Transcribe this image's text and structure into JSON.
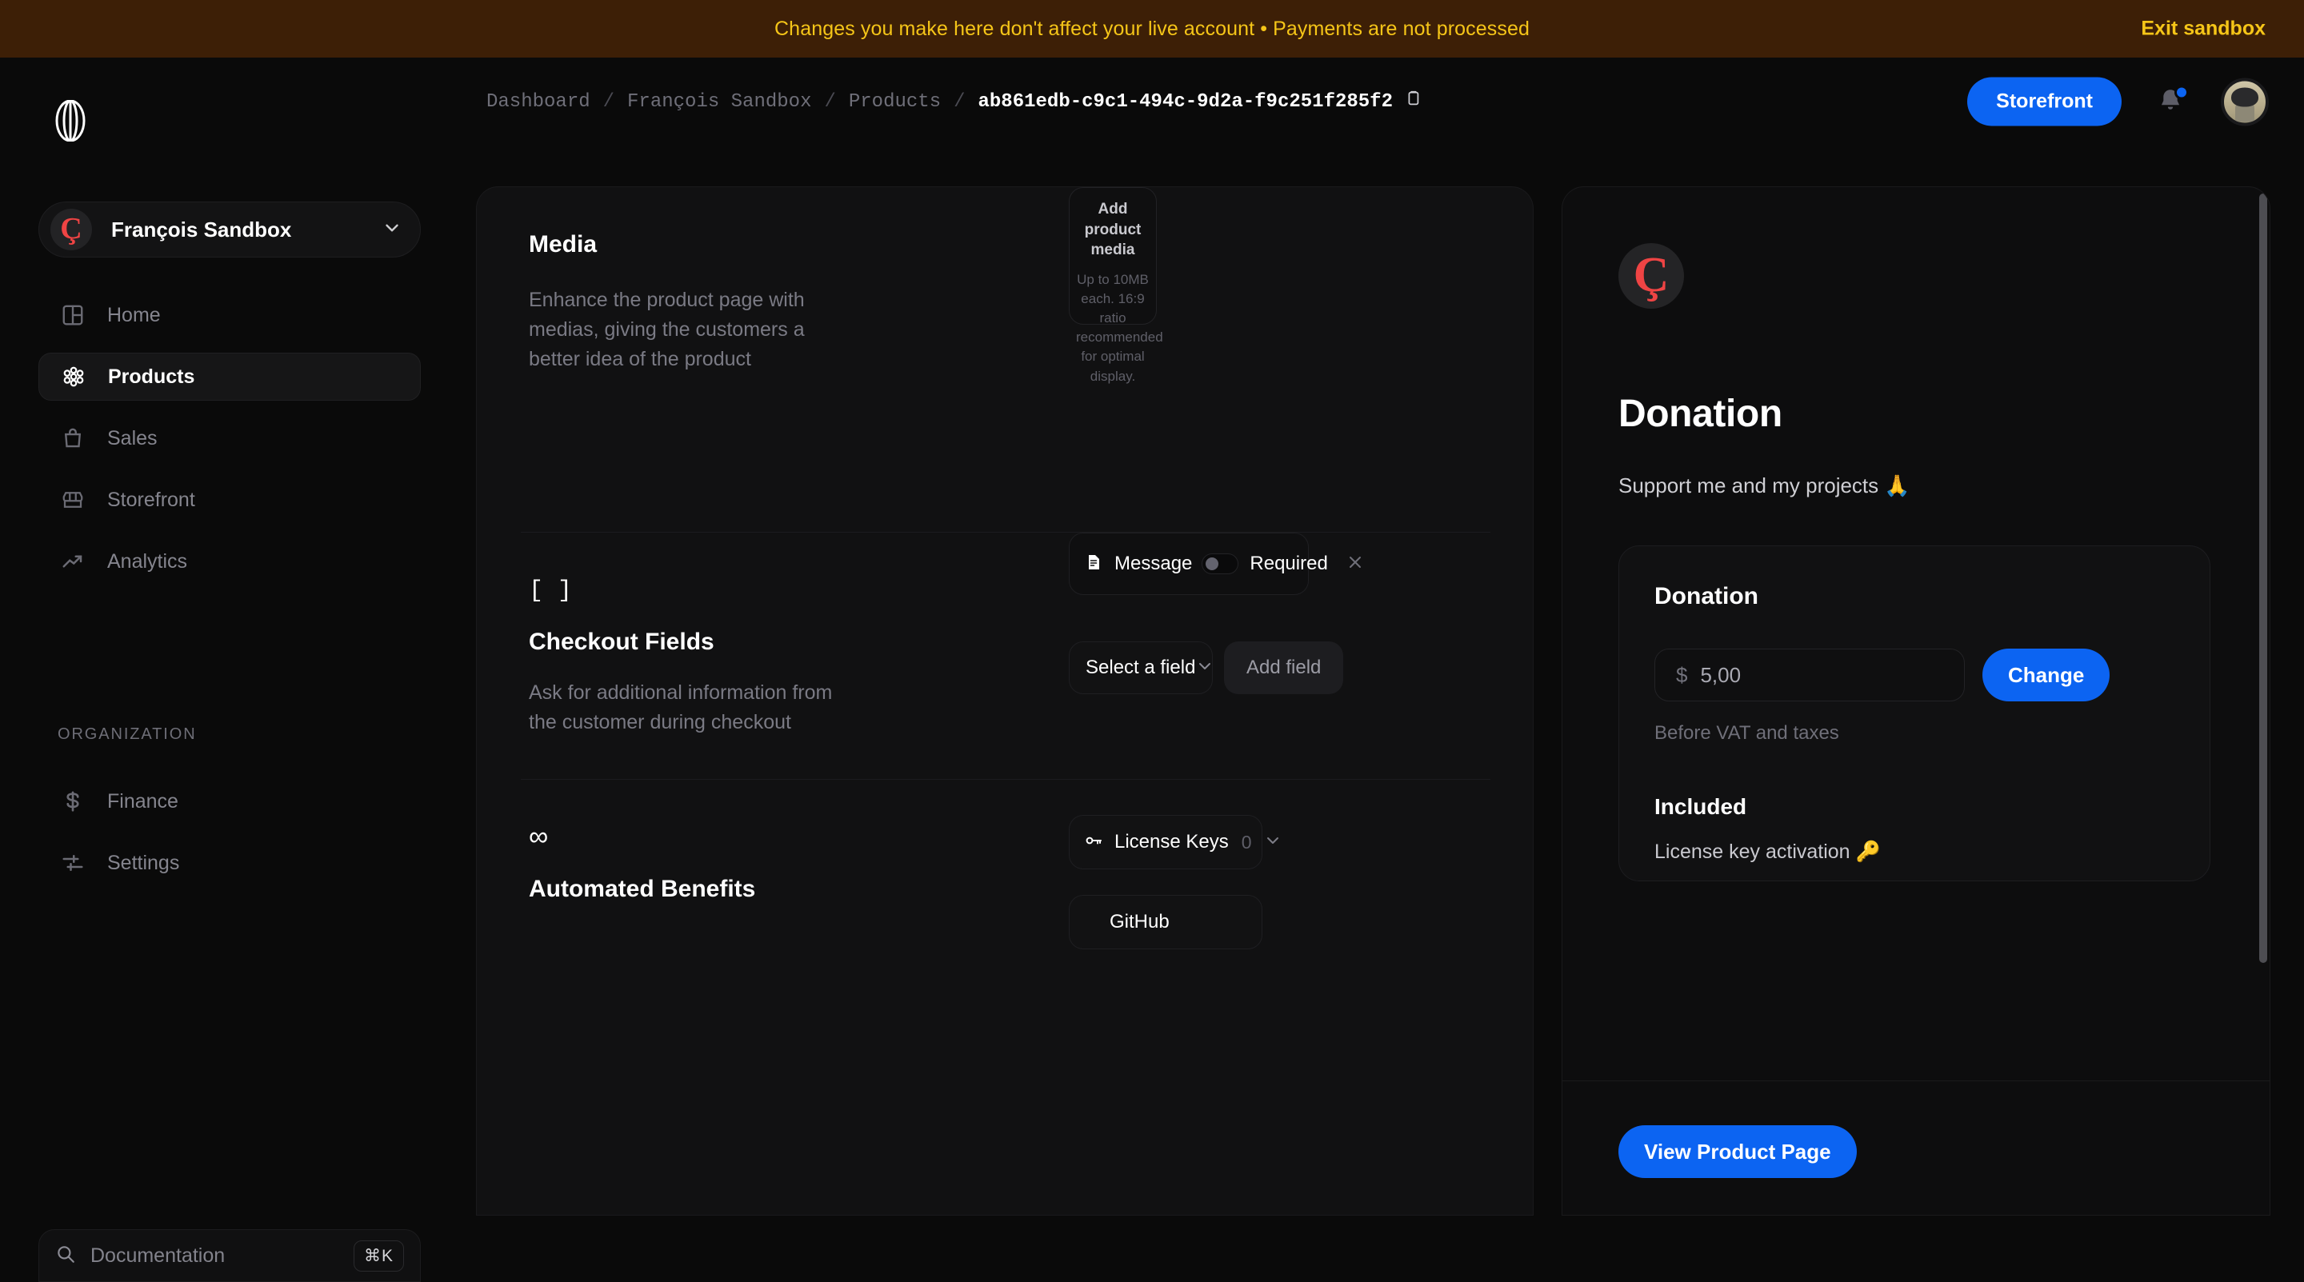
{
  "banner": {
    "message": "Changes you make here don't affect your live account • Payments are not processed",
    "exit_label": "Exit sandbox",
    "bg_color": "#3d1f06",
    "text_color": "#f5c518"
  },
  "sidebar": {
    "logo_icon": "polar-logo-icon",
    "org_switcher": {
      "avatar_letter": "Ç",
      "name": "François Sandbox",
      "chevron_icon": "chevron-down-icon"
    },
    "nav_main": [
      {
        "label": "Home",
        "icon": "layout-dashboard-icon",
        "active": false
      },
      {
        "label": "Products",
        "icon": "flower-products-icon",
        "active": true
      },
      {
        "label": "Sales",
        "icon": "shopping-bag-icon",
        "active": false
      },
      {
        "label": "Storefront",
        "icon": "storefront-icon",
        "active": false
      },
      {
        "label": "Analytics",
        "icon": "trending-up-icon",
        "active": false
      }
    ],
    "org_section_heading": "ORGANIZATION",
    "nav_org": [
      {
        "label": "Finance",
        "icon": "dollar-sign-icon",
        "active": false
      },
      {
        "label": "Settings",
        "icon": "sliders-icon",
        "active": false
      }
    ],
    "doc_search": {
      "icon": "search-icon",
      "placeholder": "Documentation",
      "shortcut": "⌘K"
    }
  },
  "topbar": {
    "breadcrumb": {
      "items": [
        "Dashboard",
        "François Sandbox",
        "Products"
      ],
      "separator": "/",
      "current": "ab861edb-c9c1-494c-9d2a-f9c251f285f2",
      "copy_icon": "clipboard-copy-icon"
    },
    "storefront_button": "Storefront",
    "storefront_color": "#0c64f2",
    "bell_icon": "bell-icon",
    "has_notification": true,
    "notification_color": "#0c64f2",
    "avatar_name": "avatar"
  },
  "editor": {
    "media": {
      "icon": "image-icon",
      "title": "Media",
      "description": "Enhance the product page with medias, giving the customers a better idea of the product",
      "dropzone": {
        "title": "Add product media",
        "hint": "Up to 10MB each. 16:9 ratio recommended for optimal display."
      }
    },
    "checkout_fields": {
      "icon": "[ ]",
      "title": "Checkout Fields",
      "description": "Ask for additional information from the customer during checkout",
      "fields": [
        {
          "icon": "text-field-icon",
          "name": "Message",
          "required_label": "Required",
          "required_toggle_on": false,
          "remove_icon": "close-icon"
        }
      ],
      "select_placeholder": "Select a field",
      "select_chevron": "chevron-down-icon",
      "add_button": "Add field"
    },
    "automated_benefits": {
      "icon": "∞",
      "title": "Automated Benefits",
      "benefits": [
        {
          "icon": "key-icon",
          "name": "License Keys",
          "count": "0",
          "chevron": "chevron-down-icon"
        },
        {
          "icon": "github-icon",
          "name": "GitHub",
          "count": "",
          "chevron": "chevron-down-icon"
        }
      ]
    }
  },
  "preview": {
    "logo_letter": "Ç",
    "title": "Donation",
    "description": "Support me and my projects 🙏",
    "card": {
      "title": "Donation",
      "currency_symbol": "$",
      "amount": "5,00",
      "change_button": "Change",
      "vat_note": "Before VAT and taxes",
      "included_heading": "Included",
      "included_item": "License key activation 🔑"
    },
    "footer_button": "View Product Page",
    "footer_button_color": "#0c64f2",
    "scrollbar_visible": true
  }
}
